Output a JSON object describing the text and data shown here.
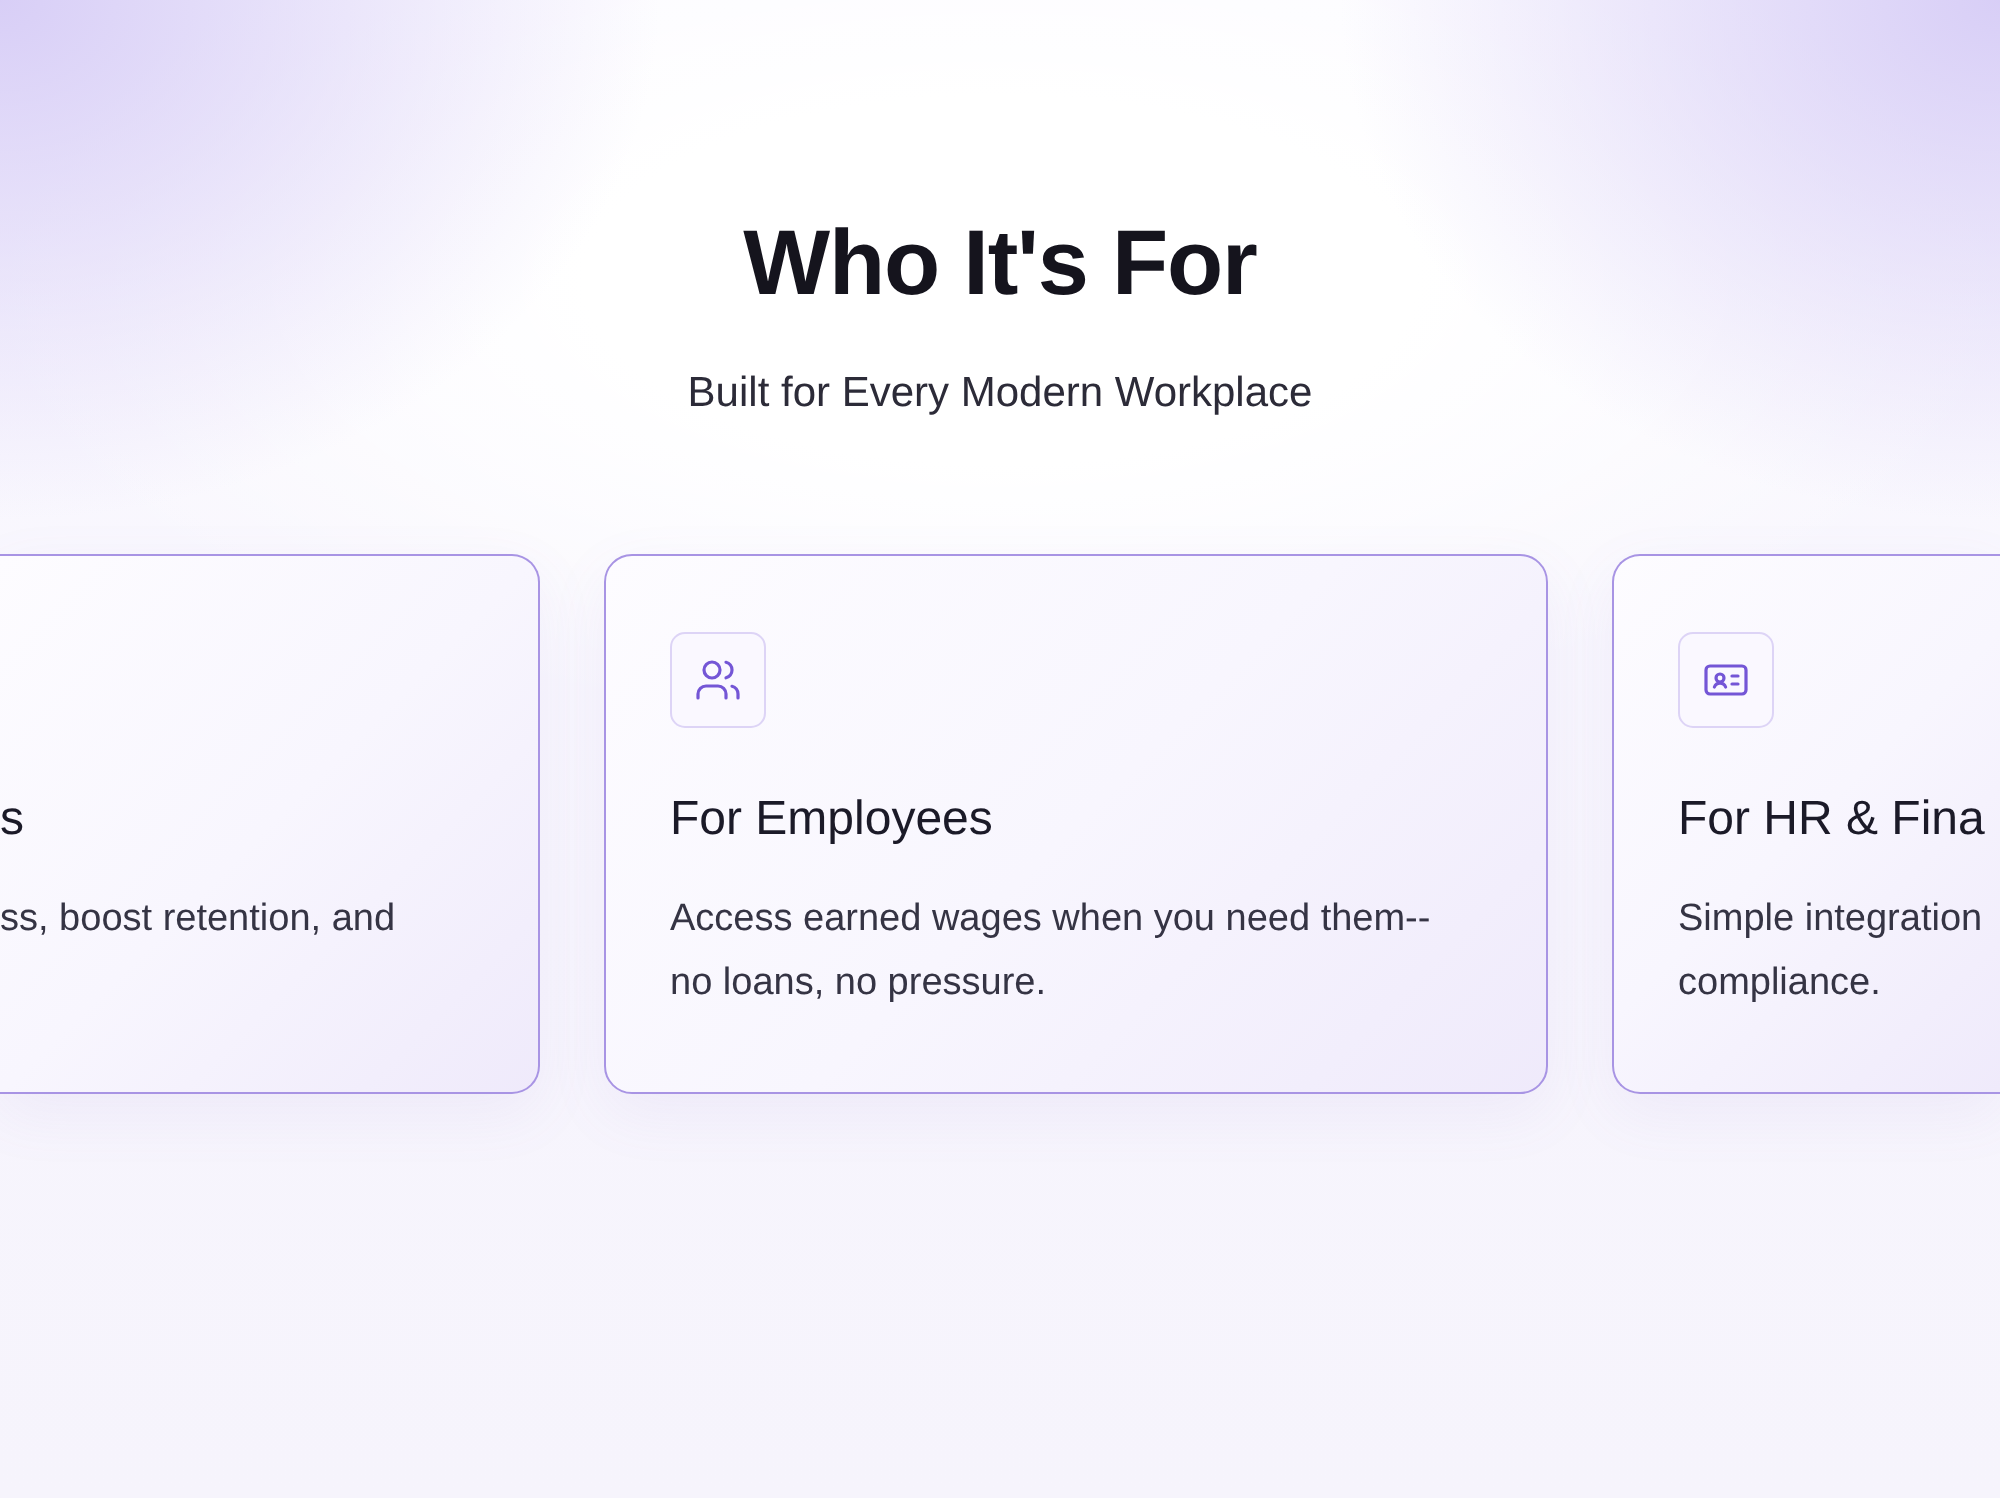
{
  "section": {
    "title": "Who It's For",
    "subtitle": "Built for Every Modern Workplace"
  },
  "cards": [
    {
      "title": "s",
      "description": "ss, boost retention, and"
    },
    {
      "title": "For Employees",
      "description": "Access earned wages when you need them-- no loans, no pressure."
    },
    {
      "title": "For HR & Fina",
      "description": "Simple integration compliance."
    }
  ]
}
